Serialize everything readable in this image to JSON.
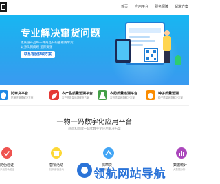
{
  "header": {
    "nav": [
      {
        "label": "首页"
      },
      {
        "label": "应用平台"
      },
      {
        "label": "服务保障"
      },
      {
        "label": "解决方案"
      }
    ]
  },
  "banner": {
    "title": "专业解决窜货问题",
    "subtitle_line1": "建属值产品每一件商品扫码查看防窜货",
    "subtitle_line2": "从源头到终端 追踪溯源",
    "button_label": "联系客服获取方案"
  },
  "features": [
    {
      "title": "防窜货平台",
      "desc": "防窜货管理解决方案",
      "icon": "shield-icon",
      "color": "#1e88e5"
    },
    {
      "title": "农产品质量追溯平台",
      "desc": "农产品质量追溯解决方案",
      "icon": "leaf-icon",
      "color": "#e53935"
    },
    {
      "title": "农药质量追溯平台",
      "desc": "农药质量追溯解决方案",
      "icon": "flask-icon",
      "color": "#43a047"
    },
    {
      "title": "种子质量追溯",
      "desc": "种子质量追溯解决方案",
      "icon": "seed-icon",
      "color": "#fb8c00"
    }
  ],
  "section": {
    "title": "一物一码数字化应用平台",
    "subtitle": "商品和品牌一站式数字化应用解决方案"
  },
  "cards": [
    {
      "label": "防伪验证",
      "desc": "产品防伪验证",
      "icon": "badge-check-icon",
      "color": "#ef5350"
    },
    {
      "label": "营销活动",
      "desc": "扫码营销活动",
      "icon": "gift-icon",
      "color": "#fdd835"
    },
    {
      "label": "防窜货",
      "desc": "渠道管控",
      "icon": "route-icon",
      "color": "#42a5f5"
    },
    {
      "label": "数据统计",
      "desc": "大数据分析",
      "icon": "chart-icon",
      "color": "#ab47bc"
    }
  ],
  "watermark": {
    "text": "领航网站导航"
  }
}
